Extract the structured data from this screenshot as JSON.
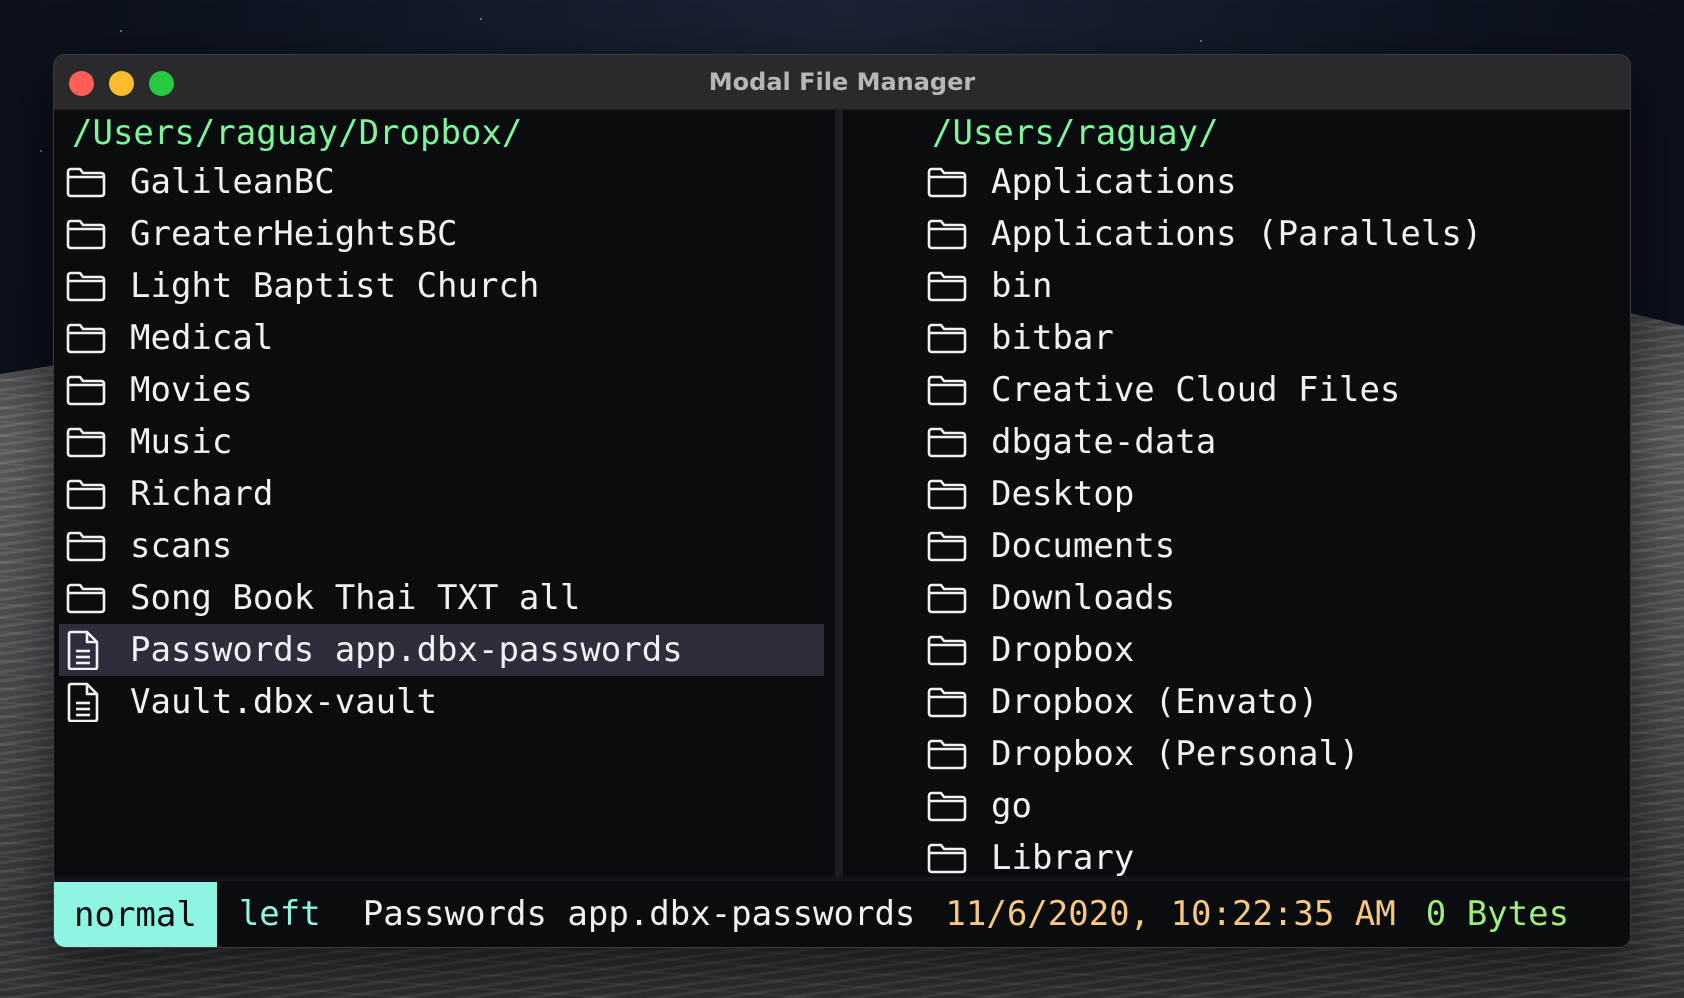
{
  "window": {
    "title": "Modal File Manager"
  },
  "left_pane": {
    "path": "/Users/raguay/Dropbox/",
    "items": [
      {
        "name": "GalileanBC",
        "type": "folder"
      },
      {
        "name": "GreaterHeightsBC",
        "type": "folder"
      },
      {
        "name": "Light Baptist Church",
        "type": "folder"
      },
      {
        "name": "Medical",
        "type": "folder"
      },
      {
        "name": "Movies",
        "type": "folder"
      },
      {
        "name": "Music",
        "type": "folder"
      },
      {
        "name": "Richard",
        "type": "folder"
      },
      {
        "name": "scans",
        "type": "folder"
      },
      {
        "name": "Song Book Thai TXT all",
        "type": "folder"
      },
      {
        "name": "Passwords app.dbx-passwords",
        "type": "file",
        "selected": true
      },
      {
        "name": "Vault.dbx-vault",
        "type": "file"
      }
    ]
  },
  "right_pane": {
    "path": "/Users/raguay/",
    "items": [
      {
        "name": "Applications",
        "type": "folder"
      },
      {
        "name": "Applications (Parallels)",
        "type": "folder"
      },
      {
        "name": "bin",
        "type": "folder"
      },
      {
        "name": "bitbar",
        "type": "folder"
      },
      {
        "name": "Creative Cloud Files",
        "type": "folder"
      },
      {
        "name": "dbgate-data",
        "type": "folder"
      },
      {
        "name": "Desktop",
        "type": "folder"
      },
      {
        "name": "Documents",
        "type": "folder"
      },
      {
        "name": "Downloads",
        "type": "folder"
      },
      {
        "name": "Dropbox",
        "type": "folder"
      },
      {
        "name": "Dropbox (Envato)",
        "type": "folder"
      },
      {
        "name": "Dropbox (Personal)",
        "type": "folder"
      },
      {
        "name": "go",
        "type": "folder"
      },
      {
        "name": "Library",
        "type": "folder"
      }
    ]
  },
  "status": {
    "mode": "normal",
    "side": "left",
    "file_name": "Passwords app.dbx-passwords",
    "file_date": "11/6/2020, 10:22:35 AM",
    "file_size": "0 Bytes"
  },
  "colors": {
    "path": "#7ef59b",
    "mode_bg": "#8ff5e3",
    "date": "#f7c97f",
    "size": "#9bf07e",
    "selection": "#2d2e3b"
  },
  "icons": {
    "folder": "folder-icon",
    "file": "file-icon"
  }
}
